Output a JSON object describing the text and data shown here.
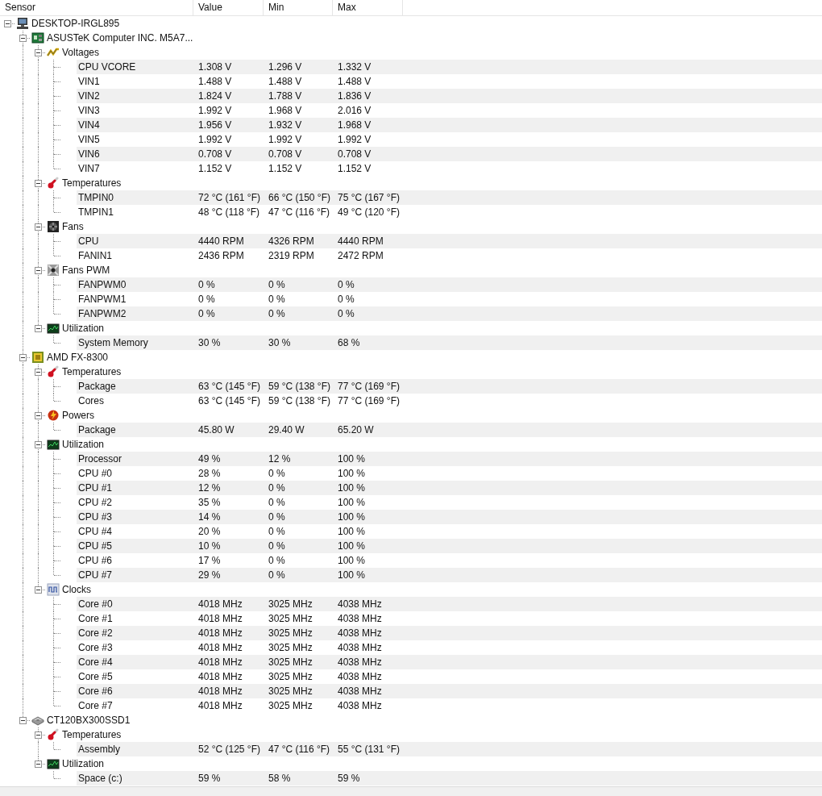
{
  "columns": [
    "Sensor",
    "Value",
    "Min",
    "Max"
  ],
  "tree": [
    {
      "name": "DESKTOP-IRGL895",
      "kind": "computer",
      "expanded": true,
      "children": [
        {
          "name": "ASUSTeK Computer INC. M5A7...",
          "kind": "mainboard",
          "expanded": true,
          "children": [
            {
              "name": "Voltages",
              "kind": "voltage",
              "expanded": true,
              "children": [
                {
                  "name": "CPU VCORE",
                  "value": "1.308 V",
                  "min": "1.296 V",
                  "max": "1.332 V"
                },
                {
                  "name": "VIN1",
                  "value": "1.488 V",
                  "min": "1.488 V",
                  "max": "1.488 V"
                },
                {
                  "name": "VIN2",
                  "value": "1.824 V",
                  "min": "1.788 V",
                  "max": "1.836 V"
                },
                {
                  "name": "VIN3",
                  "value": "1.992 V",
                  "min": "1.968 V",
                  "max": "2.016 V"
                },
                {
                  "name": "VIN4",
                  "value": "1.956 V",
                  "min": "1.932 V",
                  "max": "1.968 V"
                },
                {
                  "name": "VIN5",
                  "value": "1.992 V",
                  "min": "1.992 V",
                  "max": "1.992 V"
                },
                {
                  "name": "VIN6",
                  "value": "0.708 V",
                  "min": "0.708 V",
                  "max": "0.708 V"
                },
                {
                  "name": "VIN7",
                  "value": "1.152 V",
                  "min": "1.152 V",
                  "max": "1.152 V"
                }
              ]
            },
            {
              "name": "Temperatures",
              "kind": "temperature",
              "expanded": true,
              "children": [
                {
                  "name": "TMPIN0",
                  "value": "72 °C (161 °F)",
                  "min": "66 °C (150 °F)",
                  "max": "75 °C (167 °F)"
                },
                {
                  "name": "TMPIN1",
                  "value": "48 °C (118 °F)",
                  "min": "47 °C (116 °F)",
                  "max": "49 °C (120 °F)"
                }
              ]
            },
            {
              "name": "Fans",
              "kind": "fan",
              "expanded": true,
              "children": [
                {
                  "name": "CPU",
                  "value": "4440 RPM",
                  "min": "4326 RPM",
                  "max": "4440 RPM"
                },
                {
                  "name": "FANIN1",
                  "value": "2436 RPM",
                  "min": "2319 RPM",
                  "max": "2472 RPM"
                }
              ]
            },
            {
              "name": "Fans PWM",
              "kind": "fanpwm",
              "expanded": true,
              "children": [
                {
                  "name": "FANPWM0",
                  "value": "0 %",
                  "min": "0 %",
                  "max": "0 %"
                },
                {
                  "name": "FANPWM1",
                  "value": "0 %",
                  "min": "0 %",
                  "max": "0 %"
                },
                {
                  "name": "FANPWM2",
                  "value": "0 %",
                  "min": "0 %",
                  "max": "0 %"
                }
              ]
            },
            {
              "name": "Utilization",
              "kind": "load",
              "expanded": true,
              "children": [
                {
                  "name": "System Memory",
                  "value": "30 %",
                  "min": "30 %",
                  "max": "68 %"
                }
              ]
            }
          ]
        },
        {
          "name": "AMD FX-8300",
          "kind": "cpu",
          "expanded": true,
          "children": [
            {
              "name": "Temperatures",
              "kind": "temperature",
              "expanded": true,
              "children": [
                {
                  "name": "Package",
                  "value": "63 °C (145 °F)",
                  "min": "59 °C (138 °F)",
                  "max": "77 °C (169 °F)"
                },
                {
                  "name": "Cores",
                  "value": "63 °C (145 °F)",
                  "min": "59 °C (138 °F)",
                  "max": "77 °C (169 °F)"
                }
              ]
            },
            {
              "name": "Powers",
              "kind": "power",
              "expanded": true,
              "children": [
                {
                  "name": "Package",
                  "value": "45.80 W",
                  "min": "29.40 W",
                  "max": "65.20 W"
                }
              ]
            },
            {
              "name": "Utilization",
              "kind": "load",
              "expanded": true,
              "children": [
                {
                  "name": "Processor",
                  "value": "49 %",
                  "min": "12 %",
                  "max": "100 %"
                },
                {
                  "name": "CPU #0",
                  "value": "28 %",
                  "min": "0 %",
                  "max": "100 %"
                },
                {
                  "name": "CPU #1",
                  "value": "12 %",
                  "min": "0 %",
                  "max": "100 %"
                },
                {
                  "name": "CPU #2",
                  "value": "35 %",
                  "min": "0 %",
                  "max": "100 %"
                },
                {
                  "name": "CPU #3",
                  "value": "14 %",
                  "min": "0 %",
                  "max": "100 %"
                },
                {
                  "name": "CPU #4",
                  "value": "20 %",
                  "min": "0 %",
                  "max": "100 %"
                },
                {
                  "name": "CPU #5",
                  "value": "10 %",
                  "min": "0 %",
                  "max": "100 %"
                },
                {
                  "name": "CPU #6",
                  "value": "17 %",
                  "min": "0 %",
                  "max": "100 %"
                },
                {
                  "name": "CPU #7",
                  "value": "29 %",
                  "min": "0 %",
                  "max": "100 %"
                }
              ]
            },
            {
              "name": "Clocks",
              "kind": "clock",
              "expanded": true,
              "children": [
                {
                  "name": "Core #0",
                  "value": "4018 MHz",
                  "min": "3025 MHz",
                  "max": "4038 MHz"
                },
                {
                  "name": "Core #1",
                  "value": "4018 MHz",
                  "min": "3025 MHz",
                  "max": "4038 MHz"
                },
                {
                  "name": "Core #2",
                  "value": "4018 MHz",
                  "min": "3025 MHz",
                  "max": "4038 MHz"
                },
                {
                  "name": "Core #3",
                  "value": "4018 MHz",
                  "min": "3025 MHz",
                  "max": "4038 MHz"
                },
                {
                  "name": "Core #4",
                  "value": "4018 MHz",
                  "min": "3025 MHz",
                  "max": "4038 MHz"
                },
                {
                  "name": "Core #5",
                  "value": "4018 MHz",
                  "min": "3025 MHz",
                  "max": "4038 MHz"
                },
                {
                  "name": "Core #6",
                  "value": "4018 MHz",
                  "min": "3025 MHz",
                  "max": "4038 MHz"
                },
                {
                  "name": "Core #7",
                  "value": "4018 MHz",
                  "min": "3025 MHz",
                  "max": "4038 MHz"
                }
              ]
            }
          ]
        },
        {
          "name": "CT120BX300SSD1",
          "kind": "disk",
          "expanded": true,
          "children": [
            {
              "name": "Temperatures",
              "kind": "temperature",
              "expanded": true,
              "children": [
                {
                  "name": "Assembly",
                  "value": "52 °C (125 °F)",
                  "min": "47 °C (116 °F)",
                  "max": "55 °C (131 °F)"
                }
              ]
            },
            {
              "name": "Utilization",
              "kind": "load",
              "expanded": true,
              "children": [
                {
                  "name": "Space (c:)",
                  "value": "59 %",
                  "min": "58 %",
                  "max": "59 %"
                }
              ]
            }
          ]
        }
      ]
    }
  ]
}
